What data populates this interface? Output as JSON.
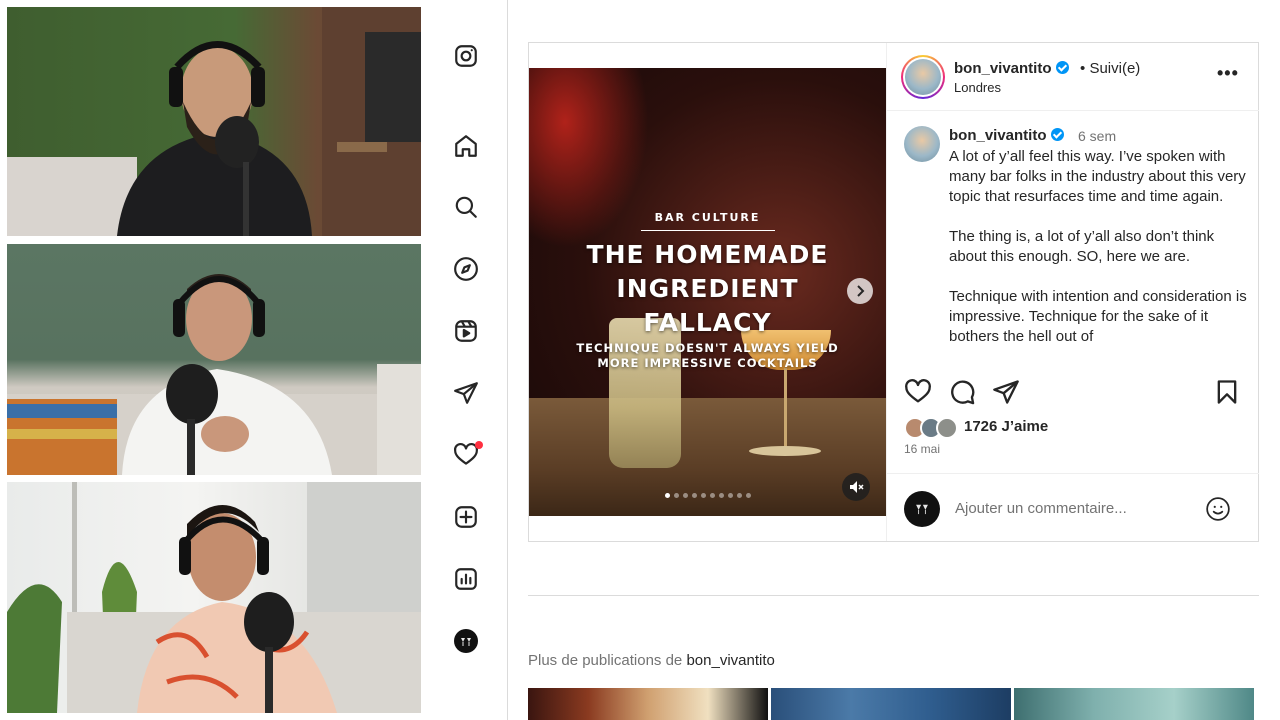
{
  "sidebar": {
    "items": [
      {
        "icon": "instagram-logo-icon"
      },
      {
        "icon": "home-icon"
      },
      {
        "icon": "search-icon"
      },
      {
        "icon": "explore-compass-icon"
      },
      {
        "icon": "reels-icon"
      },
      {
        "icon": "messages-send-icon"
      },
      {
        "icon": "notifications-heart-icon"
      },
      {
        "icon": "create-plus-icon"
      },
      {
        "icon": "dashboard-chart-icon"
      },
      {
        "icon": "profile-avatar-icon"
      }
    ],
    "notification_color": "#ff3040"
  },
  "post": {
    "author": {
      "username": "bon_vivantito",
      "separator": "•",
      "follow_status": "Suivi(e)",
      "location": "Londres",
      "verified": true
    },
    "media": {
      "kicker": "BAR CULTURE",
      "title_lines": [
        "THE HOMEMADE",
        "INGREDIENT",
        "FALLACY"
      ],
      "subtitle_lines": [
        "TECHNIQUE DOESN'T ALWAYS YIELD",
        "MORE IMPRESSIVE COCKTAILS"
      ],
      "slide_count": 10,
      "active_slide": 1
    },
    "caption": {
      "username": "bon_vivantito",
      "time": "6 sem",
      "text": "A lot of y’all feel this way. I’ve spoken with many bar folks in the industry about this very topic that resurfaces time and time again.\n\nThe thing is, a lot of y’all also don’t think about this enough. SO, here we are.\n\nTechnique with intention and consideration is impressive. Technique for the sake of it bothers the hell out of"
    },
    "likes": "1726 J’aime",
    "date": "16 mai",
    "comment_placeholder": "Ajouter un commentaire..."
  },
  "more_posts": {
    "label": "Plus de publications de",
    "username": "bon_vivantito"
  },
  "colors": {
    "verified": "#0095f6",
    "border": "#dbdbdb",
    "muted_text": "#737373"
  }
}
